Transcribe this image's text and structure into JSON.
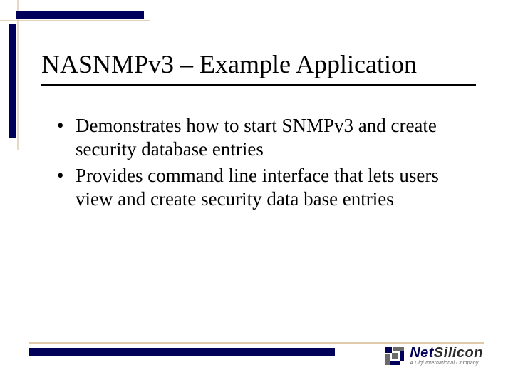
{
  "title": "NASNMPv3 – Example Application",
  "bullets": [
    "Demonstrates how to start SNMPv3 and create security database entries",
    "Provides command line interface that lets users view and create security data base entries"
  ],
  "logo": {
    "brand_left": "Net",
    "brand_right": "Silicon",
    "tagline": "A Digi International Company"
  },
  "colors": {
    "bar": "#00005a",
    "tan": "#d2b48c"
  }
}
